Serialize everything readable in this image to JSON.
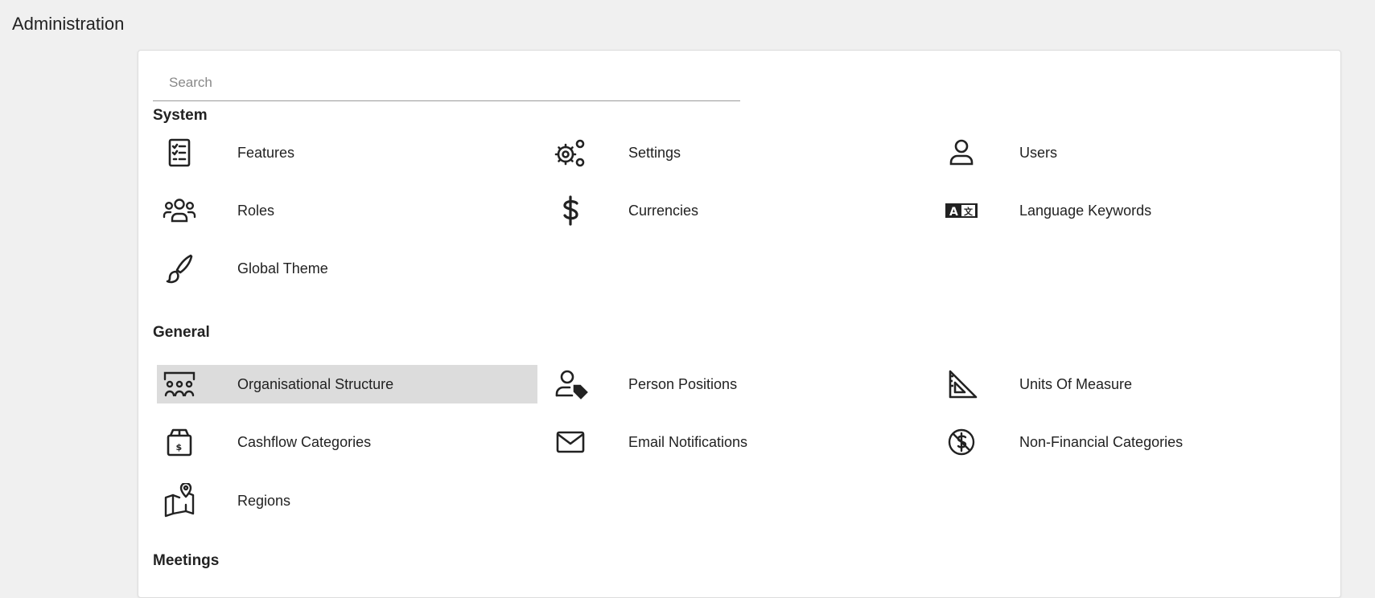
{
  "page": {
    "title": "Administration"
  },
  "search": {
    "placeholder": "Search",
    "value": ""
  },
  "sections": [
    {
      "heading": "System",
      "items": [
        {
          "label": "Features",
          "icon": "checklist-icon"
        },
        {
          "label": "Settings",
          "icon": "gears-icon"
        },
        {
          "label": "Users",
          "icon": "user-icon"
        },
        {
          "label": "Roles",
          "icon": "group-icon"
        },
        {
          "label": "Currencies",
          "icon": "dollar-icon"
        },
        {
          "label": "Language Keywords",
          "icon": "translate-icon"
        },
        {
          "label": "Global Theme",
          "icon": "paintbrush-icon"
        }
      ]
    },
    {
      "heading": "General",
      "items": [
        {
          "label": "Organisational Structure",
          "icon": "org-structure-icon",
          "selected": true
        },
        {
          "label": "Person Positions",
          "icon": "user-tag-icon"
        },
        {
          "label": "Units Of Measure",
          "icon": "ruler-triangle-icon"
        },
        {
          "label": "Cashflow Categories",
          "icon": "money-box-icon"
        },
        {
          "label": "Email Notifications",
          "icon": "envelope-icon"
        },
        {
          "label": "Non-Financial Categories",
          "icon": "no-dollar-icon"
        },
        {
          "label": "Regions",
          "icon": "map-pin-icon"
        }
      ]
    },
    {
      "heading": "Meetings",
      "items": []
    }
  ]
}
